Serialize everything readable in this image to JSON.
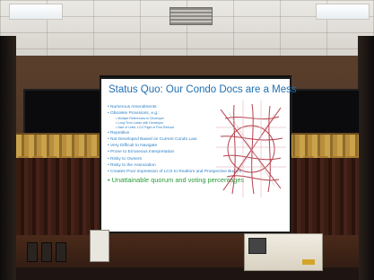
{
  "slide": {
    "title": "Status Quo: Our Condo Docs are a Mess",
    "bullets": [
      {
        "text": "Numerous Amendments",
        "level": 1
      },
      {
        "text": "Obsolete Provisions, e.g.:",
        "level": 1
      },
      {
        "text": "Multiple References to Developer",
        "level": 2
      },
      {
        "text": "Long Term Lease with Developer",
        "level": 2
      },
      {
        "text": "Sale of Units: LCG Right of First Refusal",
        "level": 2
      },
      {
        "text": "Repetitive",
        "level": 1
      },
      {
        "text": "Not Developed Based on Current Condo Law",
        "level": 1
      },
      {
        "text": "Very Difficult to Navigate",
        "level": 1
      },
      {
        "text": "Prone to Erroneous Interpretation",
        "level": 1
      },
      {
        "text": "Risky to Owners",
        "level": 1
      },
      {
        "text": "Risky to the Association",
        "level": 1
      },
      {
        "text": "Creates Poor Impression of LCG to Realtors and Prospective Buyers",
        "level": 1
      }
    ],
    "highlight_bullet": "Unattainable quorum and voting percentages",
    "colors": {
      "title": "#1f6fb2",
      "bullet": "#2d7fc4",
      "highlight": "#2a9a3a",
      "map_lines": "#b5404c"
    }
  },
  "scene": {
    "icons": [
      "ceiling-light",
      "ceiling-vent",
      "projector-screen",
      "tv-left",
      "tv-right",
      "podium",
      "curtain-valance"
    ]
  }
}
